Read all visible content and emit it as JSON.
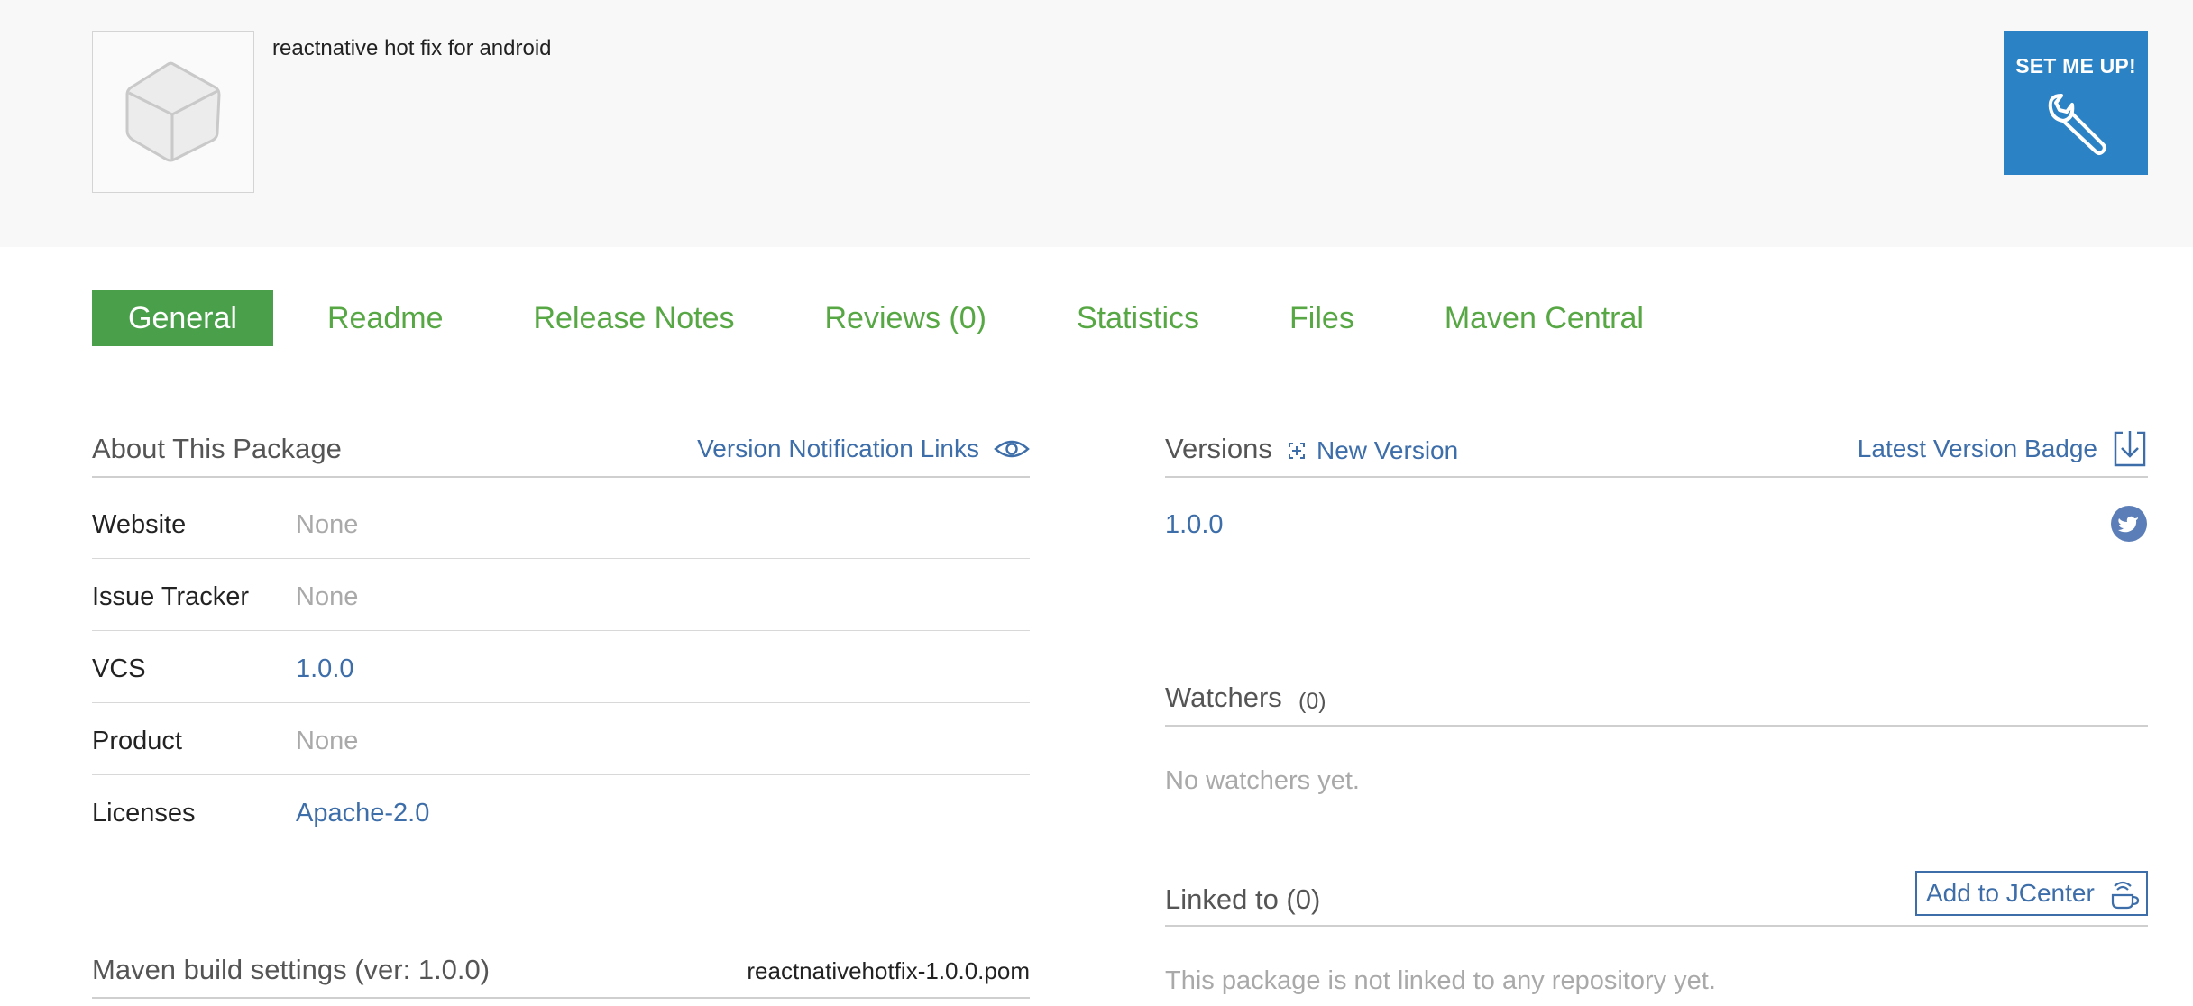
{
  "package": {
    "description": "reactnative hot fix for android",
    "image_icon": "box-icon"
  },
  "setup": {
    "label": "SET ME UP!",
    "icon": "wrench-icon"
  },
  "tabs": [
    {
      "label": "General",
      "active": true
    },
    {
      "label": "Readme"
    },
    {
      "label": "Release Notes"
    },
    {
      "label": "Reviews (0)"
    },
    {
      "label": "Statistics"
    },
    {
      "label": "Files"
    },
    {
      "label": "Maven Central"
    }
  ],
  "about": {
    "title": "About This Package",
    "notification_link": "Version Notification Links",
    "notification_icon": "eye-icon",
    "rows": [
      {
        "key": "Website",
        "value": "None"
      },
      {
        "key": "Issue Tracker",
        "value": "None"
      },
      {
        "key": "VCS",
        "value": "1.0.0"
      },
      {
        "key": "Product",
        "value": "None"
      },
      {
        "key": "Licenses",
        "value": "Apache-2.0"
      }
    ]
  },
  "maven": {
    "title": "Maven build settings (ver: 1.0.0)",
    "file": "reactnativehotfix-1.0.0.pom"
  },
  "versions": {
    "title": "Versions",
    "new_version": "New Version",
    "badge_link": "Latest Version Badge",
    "badge_icon": "download-icon",
    "items": [
      "1.0.0"
    ],
    "share_icon": "twitter-icon"
  },
  "watchers": {
    "title": "Watchers",
    "count": "(0)",
    "empty": "No watchers yet."
  },
  "linked": {
    "title": "Linked to (0)",
    "button": "Add to JCenter",
    "button_icon": "jcenter-icon",
    "empty": "This package is not linked to any repository yet."
  },
  "colors": {
    "accent_green": "#4aa04a",
    "link_blue": "#3d6ea9",
    "setup_blue": "#2b83c5"
  }
}
